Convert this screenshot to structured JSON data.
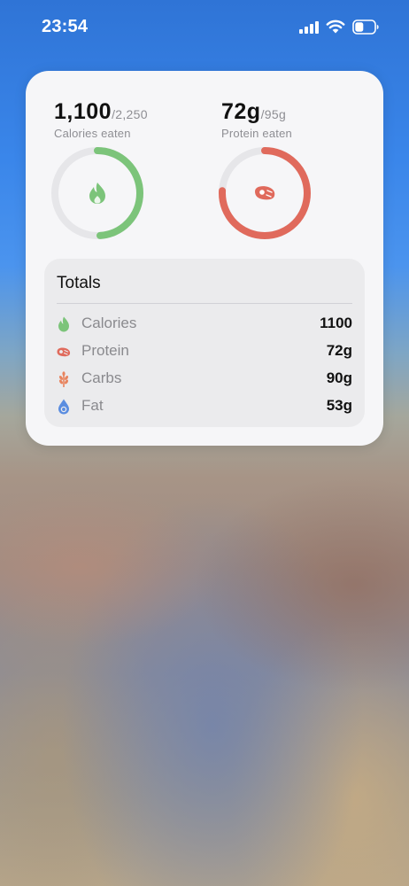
{
  "status_bar": {
    "time": "23:54"
  },
  "widget": {
    "calories": {
      "value": "1,100",
      "goal": "/2,250",
      "label": "Calories eaten",
      "progress": 0.489,
      "color": "#7cc47a"
    },
    "protein": {
      "value": "72g",
      "goal": "/95g",
      "label": "Protein eaten",
      "progress": 0.758,
      "color": "#e06a5c"
    },
    "totals": {
      "title": "Totals",
      "rows": [
        {
          "icon": "flame-icon",
          "label": "Calories",
          "value": "1100",
          "color": "#7cc47a"
        },
        {
          "icon": "steak-icon",
          "label": "Protein",
          "value": "72g",
          "color": "#e06a5c"
        },
        {
          "icon": "wheat-icon",
          "label": "Carbs",
          "value": "90g",
          "color": "#e8845e"
        },
        {
          "icon": "drop-icon",
          "label": "Fat",
          "value": "53g",
          "color": "#5a8de0"
        }
      ]
    }
  }
}
